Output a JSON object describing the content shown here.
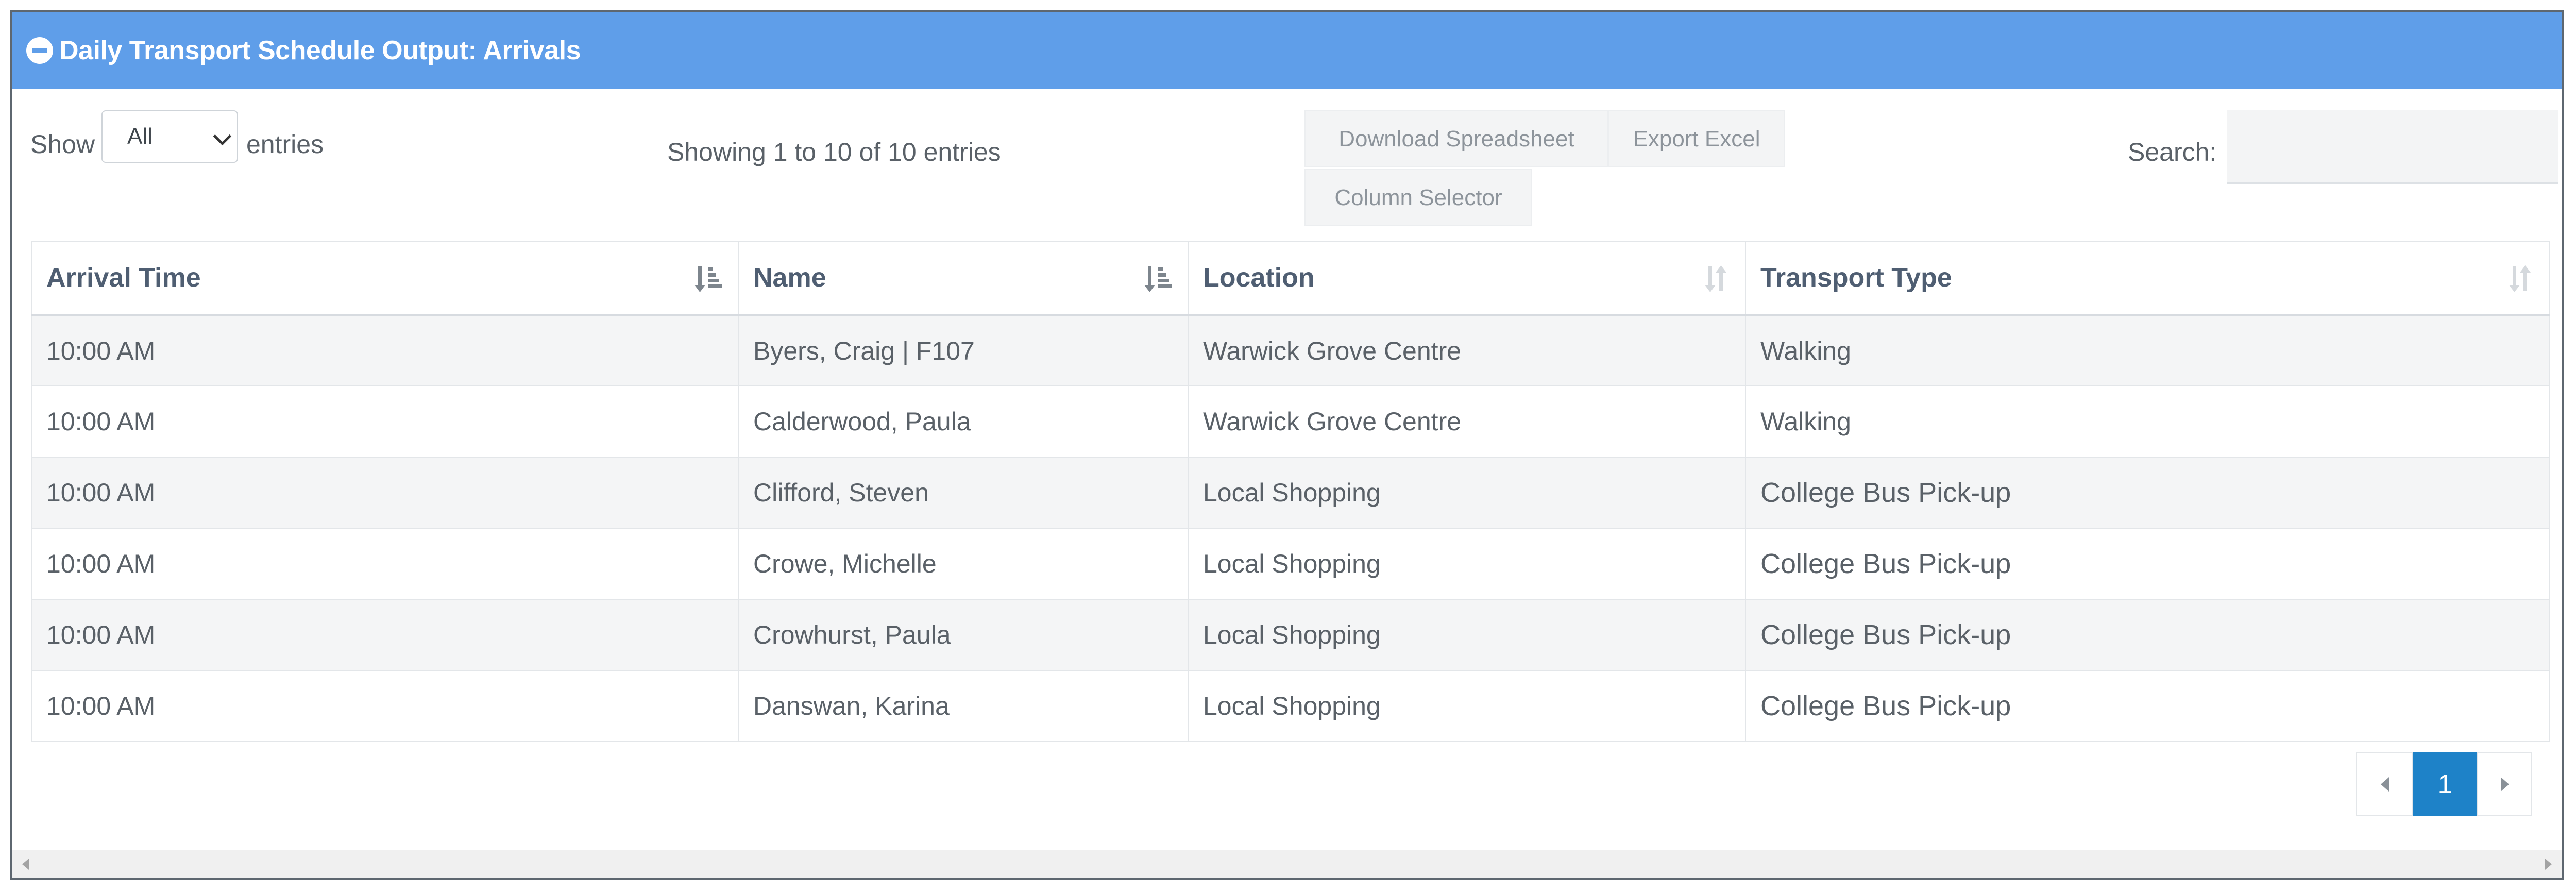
{
  "panel": {
    "title": "Daily Transport Schedule Output: Arrivals",
    "header_color": "#5f9ee9"
  },
  "controls": {
    "show_label": "Show",
    "length_value": "All",
    "entries_label": "entries",
    "info": "Showing 1 to 10 of 10 entries",
    "buttons": {
      "download": "Download Spreadsheet",
      "excel": "Export Excel",
      "columns": "Column Selector"
    },
    "search_label": "Search:",
    "search_value": ""
  },
  "table": {
    "columns": [
      {
        "label": "Arrival Time",
        "sort": "sorted-desc-icon"
      },
      {
        "label": "Name",
        "sort": "sorted-desc-icon"
      },
      {
        "label": "Location",
        "sort": "sortable-icon"
      },
      {
        "label": "Transport Type",
        "sort": "sortable-icon"
      }
    ],
    "rows": [
      [
        "10:00 AM",
        "Byers, Craig | F107",
        "Warwick Grove Centre",
        "Walking"
      ],
      [
        "10:00 AM",
        "Calderwood, Paula",
        "Warwick Grove Centre",
        "Walking"
      ],
      [
        "10:00 AM",
        "Clifford, Steven",
        "Local Shopping",
        "College Bus Pick-up"
      ],
      [
        "10:00 AM",
        "Crowe, Michelle",
        "Local Shopping",
        "College Bus Pick-up"
      ],
      [
        "10:00 AM",
        "Crowhurst, Paula",
        "Local Shopping",
        "College Bus Pick-up"
      ],
      [
        "10:00 AM",
        "Danswan, Karina",
        "Local Shopping",
        "College Bus Pick-up"
      ]
    ]
  },
  "pagination": {
    "current_page": "1",
    "active_color": "#1e82c8"
  }
}
